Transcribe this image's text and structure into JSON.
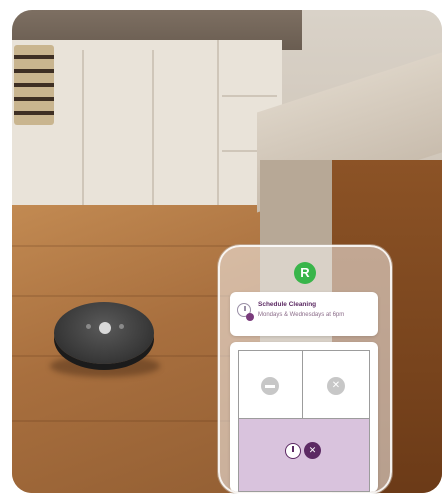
{
  "app": {
    "logo_letter": "R",
    "brand_color": "#39b54a",
    "accent_color": "#5c2a63"
  },
  "notification": {
    "title": "Schedule Cleaning",
    "subtitle": "Mondays & Wednesdays at 6pm",
    "icon": "clock-plus-icon"
  },
  "map": {
    "rooms": [
      {
        "name": "room-left",
        "icon": "bed-icon",
        "selected": false
      },
      {
        "name": "room-right",
        "icon": "close-icon",
        "selected": false
      },
      {
        "name": "room-bottom",
        "icon": "clock-icon",
        "selected": true
      }
    ]
  }
}
